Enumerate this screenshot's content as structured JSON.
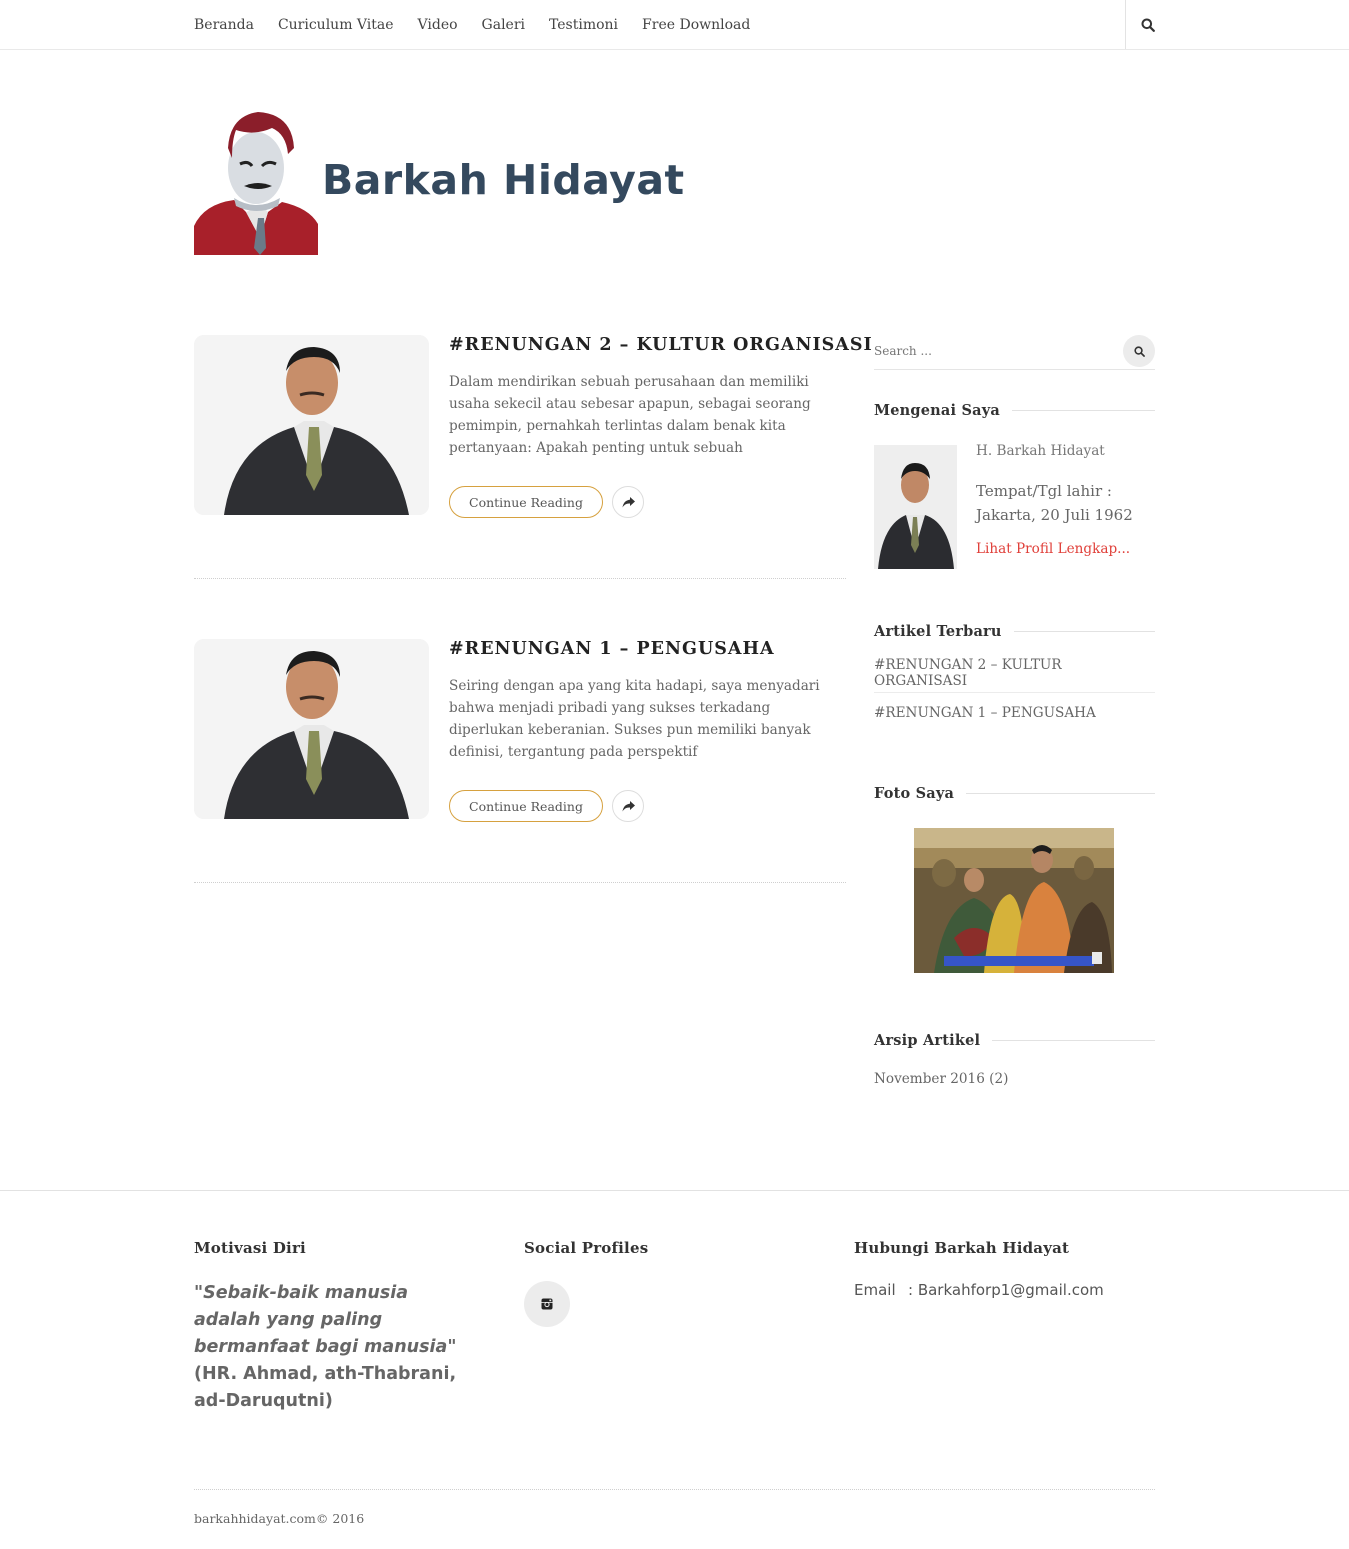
{
  "nav": {
    "items": [
      "Beranda",
      "Curiculum Vitae",
      "Video",
      "Galeri",
      "Testimoni",
      "Free Download"
    ]
  },
  "header": {
    "site_title": "Barkah Hidayat"
  },
  "posts": [
    {
      "title": "#RENUNGAN 2 – KULTUR ORGANISASI",
      "excerpt": "Dalam mendirikan sebuah perusahaan dan memiliki usaha sekecil atau sebesar apapun, sebagai seorang pemimpin, pernahkah terlintas dalam benak kita pertanyaan: Apakah penting untuk sebuah",
      "button": "Continue Reading"
    },
    {
      "title": "#RENUNGAN 1 – PENGUSAHA",
      "excerpt": "Seiring dengan apa yang kita hadapi, saya menyadari bahwa menjadi pribadi yang sukses terkadang diperlukan keberanian. Sukses pun memiliki banyak definisi, tergantung pada perspektif",
      "button": "Continue Reading"
    }
  ],
  "sidebar": {
    "search_placeholder": "Search ...",
    "about": {
      "title": "Mengenai Saya",
      "name": "H. Barkah Hidayat",
      "birth": "Tempat/Tgl lahir : Jakarta, 20 Juli 1962",
      "link": "Lihat Profil Lengkap..."
    },
    "recent": {
      "title": "Artikel Terbaru",
      "items": [
        "#RENUNGAN 2 – KULTUR ORGANISASI",
        "#RENUNGAN 1 – PENGUSAHA"
      ]
    },
    "photo": {
      "title": "Foto Saya"
    },
    "archive": {
      "title": "Arsip Artikel",
      "item": "November 2016 (2)"
    }
  },
  "footer": {
    "motivation": {
      "title": "Motivasi Diri",
      "quote_italic": "\"Sebaik-baik manusia adalah yang paling bermanfaat bagi manusia\"",
      "quote_source": " (HR. Ahmad, ath-Thabrani, ad-Daruqutni)"
    },
    "social": {
      "title": "Social Profiles"
    },
    "contact": {
      "title": "Hubungi Barkah Hidayat",
      "label": "Email",
      "value": ": Barkahforp1@gmail.com"
    },
    "copyright": "barkahhidayat.com© 2016"
  },
  "colors": {
    "accent_link": "#e0403a",
    "button_border": "#d6a13f",
    "title_blue": "#34495e"
  },
  "icons": {
    "search": "search-icon",
    "share": "share-icon",
    "social": "instagram-icon"
  }
}
